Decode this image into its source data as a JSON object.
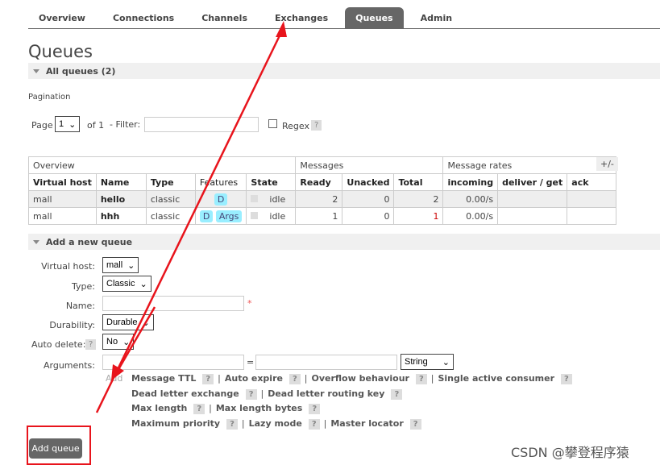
{
  "tabs": [
    "Overview",
    "Connections",
    "Channels",
    "Exchanges",
    "Queues",
    "Admin"
  ],
  "active_tab": "Queues",
  "title": "Queues",
  "all_queues": "All queues (2)",
  "pagination": {
    "label": "Pagination",
    "page_label": "Page",
    "page": "1",
    "of": "of 1",
    "filter_label": "- Filter:",
    "regex": "Regex",
    "help": "?"
  },
  "table": {
    "groups": [
      "Overview",
      "Messages",
      "Message rates"
    ],
    "plusminus": "+/-",
    "headers": [
      "Virtual host",
      "Name",
      "Type",
      "Features",
      "State",
      "Ready",
      "Unacked",
      "Total",
      "incoming",
      "deliver / get",
      "ack"
    ],
    "rows": [
      {
        "vhost": "mall",
        "name": "hello",
        "type": "classic",
        "features": [
          "D"
        ],
        "state": "idle",
        "ready": "2",
        "unacked": "0",
        "total": "2",
        "incoming": "0.00/s"
      },
      {
        "vhost": "mall",
        "name": "hhh",
        "type": "classic",
        "features": [
          "D",
          "Args"
        ],
        "state": "idle",
        "ready": "1",
        "unacked": "0",
        "total": "1",
        "incoming": "0.00/s"
      }
    ]
  },
  "add": {
    "section": "Add a new queue",
    "vhost_label": "Virtual host:",
    "vhost": "mall",
    "type_label": "Type:",
    "type": "Classic",
    "name_label": "Name:",
    "required": "*",
    "durability_label": "Durability:",
    "durability": "Durable",
    "autodelete_label": "Auto delete:",
    "autodelete": "No",
    "arguments_label": "Arguments:",
    "eq": "=",
    "argtype": "String",
    "add_label": "Add",
    "button": "Add queue",
    "args": [
      [
        "Message TTL",
        "Auto expire",
        "Overflow behaviour",
        "Single active consumer"
      ],
      [
        "Dead letter exchange",
        "Dead letter routing key"
      ],
      [
        "Max length",
        "Max length bytes"
      ],
      [
        "Maximum priority",
        "Lazy mode",
        "Master locator"
      ]
    ]
  },
  "watermark": "CSDN @攀登程序猿",
  "annotation_color": "#e8141c"
}
